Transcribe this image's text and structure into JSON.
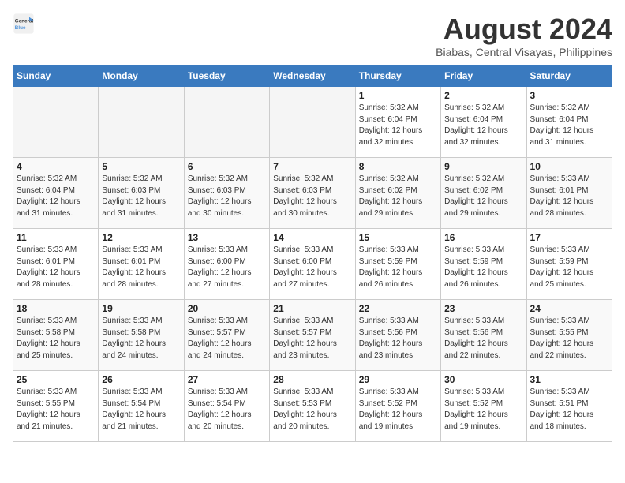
{
  "header": {
    "logo_line1": "General",
    "logo_line2": "Blue",
    "month_year": "August 2024",
    "location": "Biabas, Central Visayas, Philippines"
  },
  "weekdays": [
    "Sunday",
    "Monday",
    "Tuesday",
    "Wednesday",
    "Thursday",
    "Friday",
    "Saturday"
  ],
  "weeks": [
    [
      {
        "day": "",
        "info": ""
      },
      {
        "day": "",
        "info": ""
      },
      {
        "day": "",
        "info": ""
      },
      {
        "day": "",
        "info": ""
      },
      {
        "day": "1",
        "info": "Sunrise: 5:32 AM\nSunset: 6:04 PM\nDaylight: 12 hours\nand 32 minutes."
      },
      {
        "day": "2",
        "info": "Sunrise: 5:32 AM\nSunset: 6:04 PM\nDaylight: 12 hours\nand 32 minutes."
      },
      {
        "day": "3",
        "info": "Sunrise: 5:32 AM\nSunset: 6:04 PM\nDaylight: 12 hours\nand 31 minutes."
      }
    ],
    [
      {
        "day": "4",
        "info": "Sunrise: 5:32 AM\nSunset: 6:04 PM\nDaylight: 12 hours\nand 31 minutes."
      },
      {
        "day": "5",
        "info": "Sunrise: 5:32 AM\nSunset: 6:03 PM\nDaylight: 12 hours\nand 31 minutes."
      },
      {
        "day": "6",
        "info": "Sunrise: 5:32 AM\nSunset: 6:03 PM\nDaylight: 12 hours\nand 30 minutes."
      },
      {
        "day": "7",
        "info": "Sunrise: 5:32 AM\nSunset: 6:03 PM\nDaylight: 12 hours\nand 30 minutes."
      },
      {
        "day": "8",
        "info": "Sunrise: 5:32 AM\nSunset: 6:02 PM\nDaylight: 12 hours\nand 29 minutes."
      },
      {
        "day": "9",
        "info": "Sunrise: 5:32 AM\nSunset: 6:02 PM\nDaylight: 12 hours\nand 29 minutes."
      },
      {
        "day": "10",
        "info": "Sunrise: 5:33 AM\nSunset: 6:01 PM\nDaylight: 12 hours\nand 28 minutes."
      }
    ],
    [
      {
        "day": "11",
        "info": "Sunrise: 5:33 AM\nSunset: 6:01 PM\nDaylight: 12 hours\nand 28 minutes."
      },
      {
        "day": "12",
        "info": "Sunrise: 5:33 AM\nSunset: 6:01 PM\nDaylight: 12 hours\nand 28 minutes."
      },
      {
        "day": "13",
        "info": "Sunrise: 5:33 AM\nSunset: 6:00 PM\nDaylight: 12 hours\nand 27 minutes."
      },
      {
        "day": "14",
        "info": "Sunrise: 5:33 AM\nSunset: 6:00 PM\nDaylight: 12 hours\nand 27 minutes."
      },
      {
        "day": "15",
        "info": "Sunrise: 5:33 AM\nSunset: 5:59 PM\nDaylight: 12 hours\nand 26 minutes."
      },
      {
        "day": "16",
        "info": "Sunrise: 5:33 AM\nSunset: 5:59 PM\nDaylight: 12 hours\nand 26 minutes."
      },
      {
        "day": "17",
        "info": "Sunrise: 5:33 AM\nSunset: 5:59 PM\nDaylight: 12 hours\nand 25 minutes."
      }
    ],
    [
      {
        "day": "18",
        "info": "Sunrise: 5:33 AM\nSunset: 5:58 PM\nDaylight: 12 hours\nand 25 minutes."
      },
      {
        "day": "19",
        "info": "Sunrise: 5:33 AM\nSunset: 5:58 PM\nDaylight: 12 hours\nand 24 minutes."
      },
      {
        "day": "20",
        "info": "Sunrise: 5:33 AM\nSunset: 5:57 PM\nDaylight: 12 hours\nand 24 minutes."
      },
      {
        "day": "21",
        "info": "Sunrise: 5:33 AM\nSunset: 5:57 PM\nDaylight: 12 hours\nand 23 minutes."
      },
      {
        "day": "22",
        "info": "Sunrise: 5:33 AM\nSunset: 5:56 PM\nDaylight: 12 hours\nand 23 minutes."
      },
      {
        "day": "23",
        "info": "Sunrise: 5:33 AM\nSunset: 5:56 PM\nDaylight: 12 hours\nand 22 minutes."
      },
      {
        "day": "24",
        "info": "Sunrise: 5:33 AM\nSunset: 5:55 PM\nDaylight: 12 hours\nand 22 minutes."
      }
    ],
    [
      {
        "day": "25",
        "info": "Sunrise: 5:33 AM\nSunset: 5:55 PM\nDaylight: 12 hours\nand 21 minutes."
      },
      {
        "day": "26",
        "info": "Sunrise: 5:33 AM\nSunset: 5:54 PM\nDaylight: 12 hours\nand 21 minutes."
      },
      {
        "day": "27",
        "info": "Sunrise: 5:33 AM\nSunset: 5:54 PM\nDaylight: 12 hours\nand 20 minutes."
      },
      {
        "day": "28",
        "info": "Sunrise: 5:33 AM\nSunset: 5:53 PM\nDaylight: 12 hours\nand 20 minutes."
      },
      {
        "day": "29",
        "info": "Sunrise: 5:33 AM\nSunset: 5:52 PM\nDaylight: 12 hours\nand 19 minutes."
      },
      {
        "day": "30",
        "info": "Sunrise: 5:33 AM\nSunset: 5:52 PM\nDaylight: 12 hours\nand 19 minutes."
      },
      {
        "day": "31",
        "info": "Sunrise: 5:33 AM\nSunset: 5:51 PM\nDaylight: 12 hours\nand 18 minutes."
      }
    ]
  ]
}
